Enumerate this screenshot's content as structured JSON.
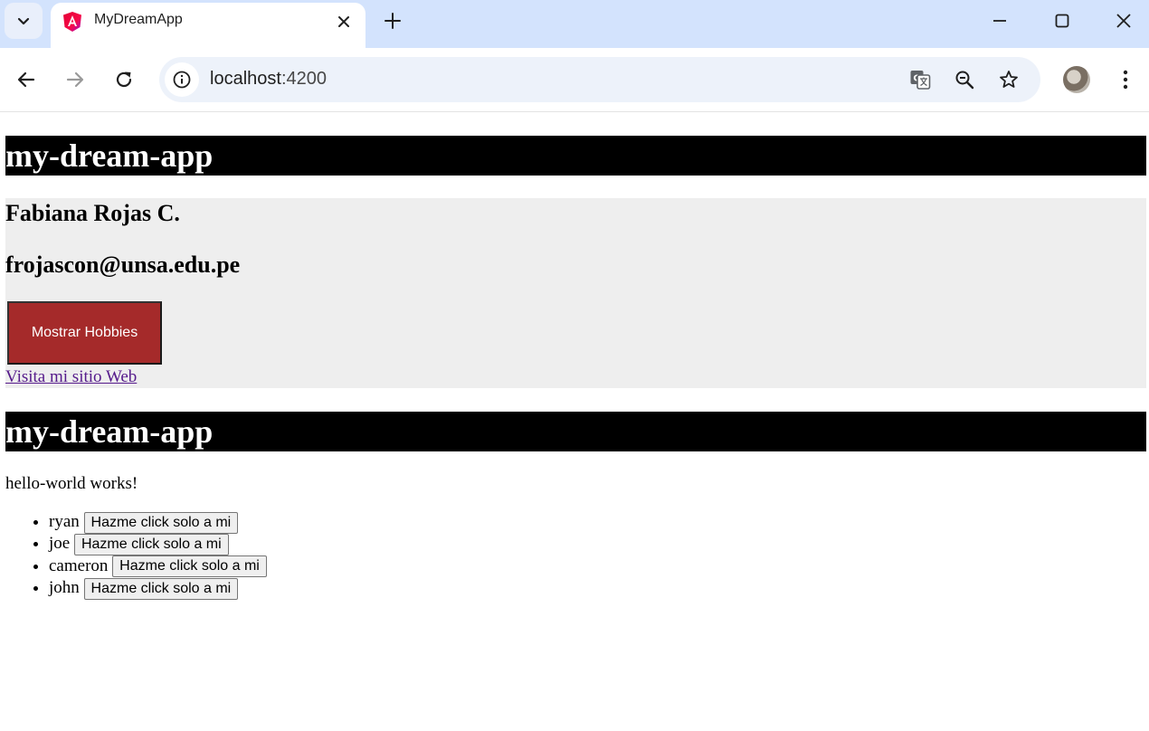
{
  "browser": {
    "tab_title": "MyDreamApp",
    "url_host": "localhost",
    "url_port": ":4200",
    "icons": {
      "tab_search": "chevron-down-icon",
      "favicon": "angular-logo-icon",
      "tab_close": "close-icon",
      "new_tab": "plus-icon",
      "back": "arrow-left-icon",
      "forward": "arrow-right-icon",
      "reload": "reload-icon",
      "site_info": "info-icon",
      "translate": "translate-icon",
      "zoom": "zoom-out-icon",
      "bookmark": "star-icon",
      "menu": "kebab-menu-icon"
    }
  },
  "page": {
    "app_title_1": "my-dream-app",
    "profile": {
      "name": "Fabiana Rojas C.",
      "email": "frojascon@unsa.edu.pe",
      "hobbies_button": "Mostrar Hobbies",
      "website_link": "Visita mi sitio Web"
    },
    "app_title_2": "my-dream-app",
    "hello_text": "hello-world works!",
    "people": [
      {
        "name": "ryan",
        "button": "Hazme click solo a mi"
      },
      {
        "name": "joe",
        "button": "Hazme click solo a mi"
      },
      {
        "name": "cameron",
        "button": "Hazme click solo a mi"
      },
      {
        "name": "john",
        "button": "Hazme click solo a mi"
      }
    ]
  },
  "colors": {
    "header_bg": "#000000",
    "profile_bg": "#eeeeee",
    "hobbies_button_bg": "#a52a2a",
    "link_visited": "#551a8b",
    "tabstrip_bg": "#d3e3fd"
  }
}
